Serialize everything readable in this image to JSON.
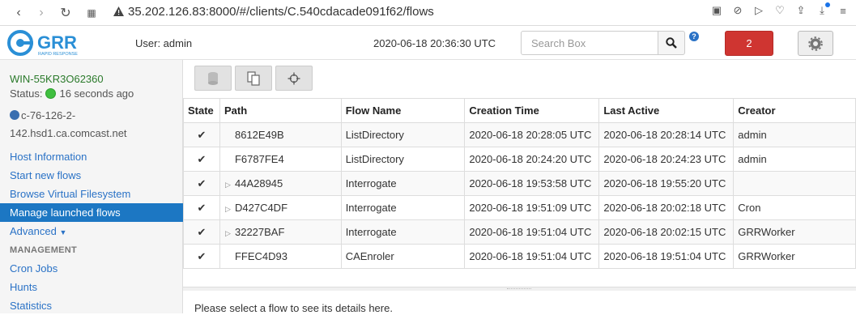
{
  "browser": {
    "url": "35.202.126.83:8000/#/clients/C.540cdacade091f62/flows"
  },
  "header": {
    "user_label": "User: admin",
    "time": "2020-06-18 20:36:30 UTC",
    "search_placeholder": "Search Box",
    "notifications": "2",
    "logo_text": "GRR",
    "logo_sub": "RAPID RESPONSE"
  },
  "sidebar": {
    "client_name": "WIN-55KR3O62360",
    "status_prefix": "Status:",
    "status_time": "16 seconds ago",
    "hostname": "c-76-126-2-142.hsd1.ca.comcast.net",
    "links": [
      {
        "label": "Host Information"
      },
      {
        "label": "Start new flows"
      },
      {
        "label": "Browse Virtual Filesystem"
      },
      {
        "label": "Manage launched flows"
      },
      {
        "label": "Advanced"
      }
    ],
    "management_heading": "MANAGEMENT",
    "management_links": [
      {
        "label": "Cron Jobs"
      },
      {
        "label": "Hunts"
      },
      {
        "label": "Statistics"
      }
    ]
  },
  "table": {
    "headers": [
      "State",
      "Path",
      "Flow Name",
      "Creation Time",
      "Last Active",
      "Creator"
    ],
    "rows": [
      {
        "path": "8612E49B",
        "name": "ListDirectory",
        "created": "2020-06-18 20:28:05 UTC",
        "active": "2020-06-18 20:28:14 UTC",
        "creator": "admin"
      },
      {
        "path": "F6787FE4",
        "name": "ListDirectory",
        "created": "2020-06-18 20:24:20 UTC",
        "active": "2020-06-18 20:24:23 UTC",
        "creator": "admin"
      },
      {
        "path": "44A28945",
        "name": "Interrogate",
        "created": "2020-06-18 19:53:58 UTC",
        "active": "2020-06-18 19:55:20 UTC",
        "creator": ""
      },
      {
        "path": "D427C4DF",
        "name": "Interrogate",
        "created": "2020-06-18 19:51:09 UTC",
        "active": "2020-06-18 20:02:18 UTC",
        "creator": "Cron"
      },
      {
        "path": "32227BAF",
        "name": "Interrogate",
        "created": "2020-06-18 19:51:04 UTC",
        "active": "2020-06-18 20:02:15 UTC",
        "creator": "GRRWorker"
      },
      {
        "path": "FFEC4D93",
        "name": "CAEnroler",
        "created": "2020-06-18 19:51:04 UTC",
        "active": "2020-06-18 19:51:04 UTC",
        "creator": "GRRWorker"
      }
    ]
  },
  "detail_message": "Please select a flow to see its details here."
}
